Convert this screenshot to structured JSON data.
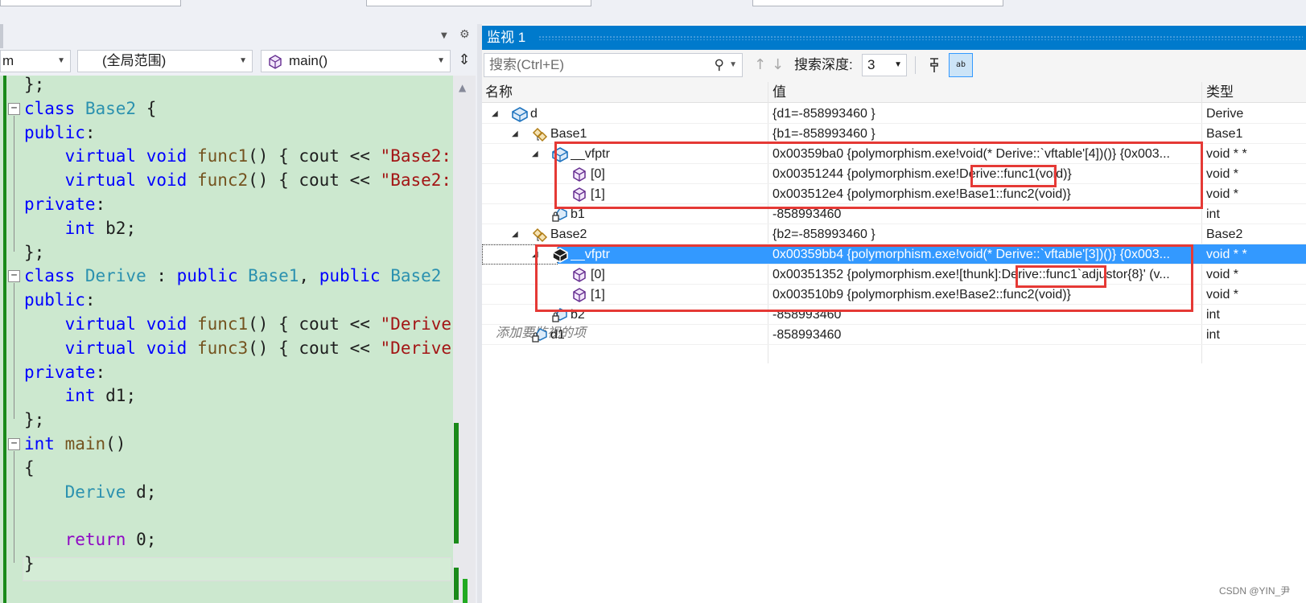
{
  "editor": {
    "combo_project": "m",
    "combo_scope": "(全局范围)",
    "combo_function": "main()",
    "lines": [
      [
        {
          "t": "};",
          "c": "pu"
        }
      ],
      [
        {
          "t": "class ",
          "c": "kw"
        },
        {
          "t": "Base2",
          "c": "ty"
        },
        {
          "t": " {",
          "c": "pu"
        }
      ],
      [
        {
          "t": "public",
          "c": "kw"
        },
        {
          "t": ":",
          "c": "pu"
        }
      ],
      [
        {
          "t": "    virtual ",
          "c": "kw"
        },
        {
          "t": "void ",
          "c": "kw"
        },
        {
          "t": "func1",
          "c": "fn"
        },
        {
          "t": "() { cout << ",
          "c": "pu"
        },
        {
          "t": "\"Base2::",
          "c": "st"
        }
      ],
      [
        {
          "t": "    virtual ",
          "c": "kw"
        },
        {
          "t": "void ",
          "c": "kw"
        },
        {
          "t": "func2",
          "c": "fn"
        },
        {
          "t": "() { cout << ",
          "c": "pu"
        },
        {
          "t": "\"Base2::",
          "c": "st"
        }
      ],
      [
        {
          "t": "private",
          "c": "kw"
        },
        {
          "t": ":",
          "c": "pu"
        }
      ],
      [
        {
          "t": "    int ",
          "c": "kw"
        },
        {
          "t": "b2;",
          "c": "pu"
        }
      ],
      [
        {
          "t": "};",
          "c": "pu"
        }
      ],
      [
        {
          "t": "class ",
          "c": "kw"
        },
        {
          "t": "Derive",
          "c": "ty"
        },
        {
          "t": " : ",
          "c": "pu"
        },
        {
          "t": "public ",
          "c": "kw"
        },
        {
          "t": "Base1",
          "c": "ty"
        },
        {
          "t": ", ",
          "c": "pu"
        },
        {
          "t": "public ",
          "c": "kw"
        },
        {
          "t": "Base2",
          "c": "ty"
        },
        {
          "t": " {",
          "c": "pu"
        }
      ],
      [
        {
          "t": "public",
          "c": "kw"
        },
        {
          "t": ":",
          "c": "pu"
        }
      ],
      [
        {
          "t": "    virtual ",
          "c": "kw"
        },
        {
          "t": "void ",
          "c": "kw"
        },
        {
          "t": "func1",
          "c": "fn"
        },
        {
          "t": "() { cout << ",
          "c": "pu"
        },
        {
          "t": "\"Derive:",
          "c": "st"
        }
      ],
      [
        {
          "t": "    virtual ",
          "c": "kw"
        },
        {
          "t": "void ",
          "c": "kw"
        },
        {
          "t": "func3",
          "c": "fn"
        },
        {
          "t": "() { cout << ",
          "c": "pu"
        },
        {
          "t": "\"Derive:",
          "c": "st"
        }
      ],
      [
        {
          "t": "private",
          "c": "kw"
        },
        {
          "t": ":",
          "c": "pu"
        }
      ],
      [
        {
          "t": "    int ",
          "c": "kw"
        },
        {
          "t": "d1;",
          "c": "pu"
        }
      ],
      [
        {
          "t": "};",
          "c": "pu"
        }
      ],
      [
        {
          "t": "int ",
          "c": "kw"
        },
        {
          "t": "main",
          "c": "fn"
        },
        {
          "t": "()",
          "c": "pu"
        }
      ],
      [
        {
          "t": "{",
          "c": "pu"
        }
      ],
      [
        {
          "t": "    ",
          "c": "pu"
        },
        {
          "t": "Derive",
          "c": "ty"
        },
        {
          "t": " d;",
          "c": "pu"
        }
      ],
      [
        {
          "t": "",
          "c": "pu"
        }
      ],
      [
        {
          "t": "    return ",
          "c": "ob"
        },
        {
          "t": "0;",
          "c": "pu"
        }
      ],
      [
        {
          "t": "}",
          "c": "pu"
        }
      ]
    ]
  },
  "watch": {
    "title": "监视 1",
    "search_placeholder": "搜索(Ctrl+E)",
    "depth_label": "搜索深度:",
    "depth_value": "3",
    "ab_button": "ab",
    "columns": {
      "name": "名称",
      "value": "值",
      "type": "类型"
    },
    "rows": [
      {
        "name": "d",
        "value": "{d1=-858993460 }",
        "type": "Derive",
        "level": 0,
        "expander": "open",
        "icon": "object-icon"
      },
      {
        "name": "Base1",
        "value": "{b1=-858993460 }",
        "type": "Base1",
        "level": 1,
        "expander": "open",
        "icon": "base-class-icon"
      },
      {
        "name": "__vfptr",
        "value": "0x00359ba0 {polymorphism.exe!void(* Derive::`vftable'[4])()} {0x003...",
        "type": "void * *",
        "level": 2,
        "expander": "open",
        "icon": "object-icon"
      },
      {
        "name": "[0]",
        "value": "0x00351244 {polymorphism.exe!Derive::func1(void)}",
        "type": "void *",
        "level": 3,
        "expander": "none",
        "icon": "member-icon"
      },
      {
        "name": "[1]",
        "value": "0x003512e4 {polymorphism.exe!Base1::func2(void)}",
        "type": "void *",
        "level": 3,
        "expander": "none",
        "icon": "member-icon"
      },
      {
        "name": "b1",
        "value": "-858993460",
        "type": "int",
        "level": 2,
        "expander": "none",
        "icon": "private-field-icon"
      },
      {
        "name": "Base2",
        "value": "{b2=-858993460 }",
        "type": "Base2",
        "level": 1,
        "expander": "open",
        "icon": "base-class-icon"
      },
      {
        "name": "__vfptr",
        "value": "0x00359bb4 {polymorphism.exe!void(* Derive::`vftable'[3])()} {0x003...",
        "type": "void * *",
        "level": 2,
        "expander": "open",
        "icon": "object-icon",
        "selected": true
      },
      {
        "name": "[0]",
        "value": "0x00351352 {polymorphism.exe![thunk]:Derive::func1`adjustor{8}' (v...",
        "type": "void *",
        "level": 3,
        "expander": "none",
        "icon": "member-icon"
      },
      {
        "name": "[1]",
        "value": "0x003510b9 {polymorphism.exe!Base2::func2(void)}",
        "type": "void *",
        "level": 3,
        "expander": "none",
        "icon": "member-icon"
      },
      {
        "name": "b2",
        "value": "-858993460",
        "type": "int",
        "level": 2,
        "expander": "none",
        "icon": "private-field-icon"
      },
      {
        "name": "d1",
        "value": "-858993460",
        "type": "int",
        "level": 1,
        "expander": "none",
        "icon": "private-field-icon"
      }
    ],
    "add_item": "添加要监视的项"
  },
  "watermark": "CSDN @YIN_尹",
  "colors": {
    "accent": "#007acc",
    "code_bg": "#cce8cf",
    "highlight_box": "#e53935",
    "selection": "#3399ff"
  }
}
